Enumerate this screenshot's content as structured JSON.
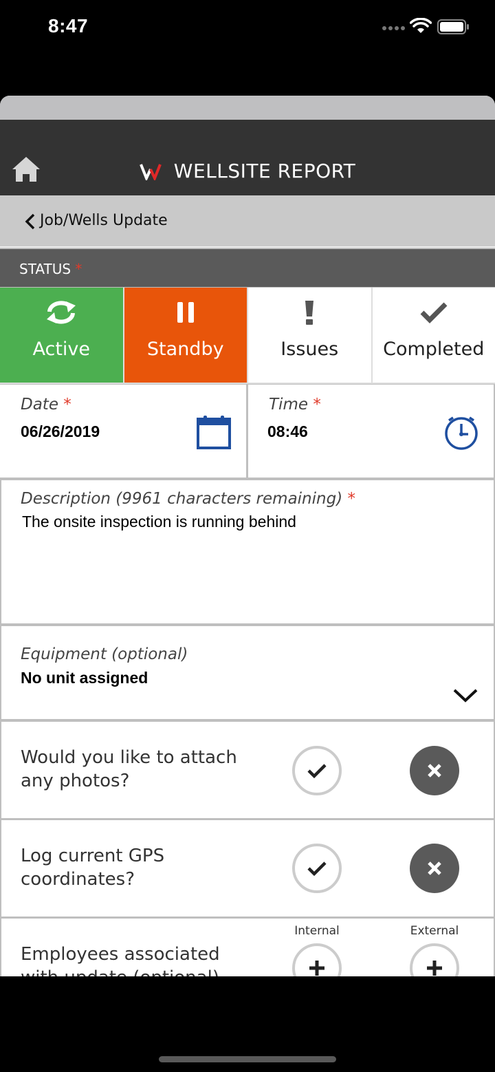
{
  "status_bar": {
    "time": "8:47"
  },
  "header": {
    "title": "WELLSITE REPORT"
  },
  "nav": {
    "back_label": "Job/Wells Update"
  },
  "status_section": {
    "label": "STATUS",
    "required_mark": "*",
    "options": [
      {
        "label": "Active",
        "icon": "refresh-icon",
        "color": "#4caf50"
      },
      {
        "label": "Standby",
        "icon": "pause-icon",
        "color": "#e8550a"
      },
      {
        "label": "Issues",
        "icon": "exclamation-icon"
      },
      {
        "label": "Completed",
        "icon": "checkmark-icon"
      }
    ]
  },
  "date": {
    "label": "Date",
    "required_mark": "*",
    "value": "06/26/2019"
  },
  "time": {
    "label": "Time",
    "required_mark": "*",
    "value": "08:46"
  },
  "description": {
    "label": "Description (9961 characters remaining)",
    "required_mark": "*",
    "value": "The onsite inspection is running behind"
  },
  "equipment": {
    "label": "Equipment (optional)",
    "value": "No unit assigned"
  },
  "questions": [
    {
      "line1": "Would you like to attach",
      "line2": "any photos?"
    },
    {
      "line1": "Log current GPS",
      "line2": "coordinates?"
    }
  ],
  "employees": {
    "line1": "Employees associated",
    "line2": "with update (optional)",
    "internal_label": "Internal",
    "external_label": "External"
  },
  "colors": {
    "header": "#333333",
    "accent_icon": "#1f4fa0",
    "required": "#e03a2a"
  }
}
